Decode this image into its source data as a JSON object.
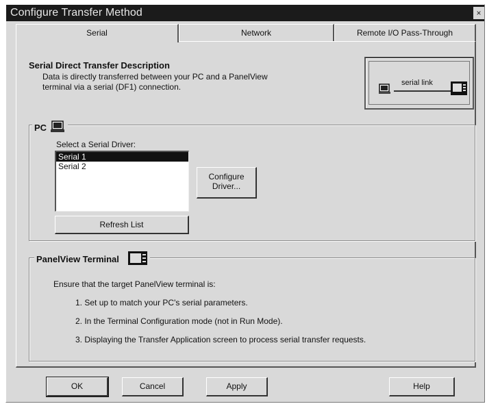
{
  "window": {
    "title": "Configure Transfer Method",
    "close_glyph": "×"
  },
  "tabs": [
    {
      "label": "Serial",
      "active": true
    },
    {
      "label": "Network",
      "active": false
    },
    {
      "label": "Remote I/O Pass-Through",
      "active": false
    }
  ],
  "description": {
    "title": "Serial Direct Transfer Description",
    "line1": "Data is directly transferred between your PC and a PanelView",
    "line2": "terminal via a serial (DF1) connection."
  },
  "diagram": {
    "label": "serial link"
  },
  "pc_group": {
    "label": "PC",
    "select_label": "Select a Serial Driver:",
    "drivers": [
      "Serial 1",
      "Serial 2"
    ],
    "selected_index": 0,
    "configure_button_line1": "Configure",
    "configure_button_line2": "Driver...",
    "refresh_button": "Refresh List"
  },
  "terminal_group": {
    "label": "PanelView Terminal",
    "intro": "Ensure that the target PanelView terminal is:",
    "steps": [
      "1.  Set up to match your PC's serial parameters.",
      "2.  In the Terminal Configuration mode (not in Run Mode).",
      "3.  Displaying the Transfer Application screen to process serial transfer requests."
    ]
  },
  "buttons": {
    "ok": "OK",
    "cancel": "Cancel",
    "apply": "Apply",
    "help": "Help"
  },
  "icons": {
    "pc": "computer-icon",
    "terminal": "panelview-terminal-icon"
  }
}
